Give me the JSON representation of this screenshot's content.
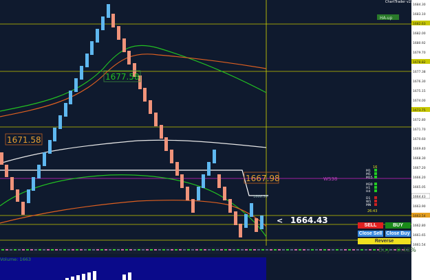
{
  "window": {
    "title": "ChartTrader v2.00"
  },
  "levels": {
    "l1": "1677.58",
    "l2": "1671.58",
    "l3": "1667.98",
    "current": "1664.43",
    "current_arrow": "<",
    "ha_badge": "HA-up",
    "ws_label": "WS38",
    "small_level": "1666.56"
  },
  "axis_prices": [
    "1684.30",
    "1683.10",
    "1682.63",
    "1682.00",
    "1680.92",
    "1679.70",
    "1678.82",
    "1677.38",
    "1676.30",
    "1675.15",
    "1674.00",
    "1673.75",
    "1672.80",
    "1671.70",
    "1670.60",
    "1669.40",
    "1668.30",
    "1667.20",
    "1666.20",
    "1665.05",
    "1664.43",
    "1663.90",
    "1663.54",
    "1662.80",
    "1661.65",
    "1661.54"
  ],
  "volume": {
    "label": "Volume: 1663"
  },
  "buy_sell_label": "Buy - 0.48%",
  "timeframes": [
    {
      "label": "M1",
      "val": ""
    },
    {
      "label": "M5",
      "val": ""
    },
    {
      "label": "M15",
      "val": ""
    },
    {
      "label": "M30",
      "val": ""
    },
    {
      "label": "H1",
      "val": ""
    },
    {
      "label": "H4",
      "val": ""
    },
    {
      "label": "D1",
      "val": ""
    },
    {
      "label": "W1",
      "val": ""
    },
    {
      "label": "MN",
      "val": ""
    }
  ],
  "tf_header": "16",
  "tf_footer": "26:43",
  "buttons": {
    "sell": "SELL",
    "buy": "BUY",
    "close_sell": "Close Sell",
    "close_buy": "Close Buy",
    "reverse": "Reverse"
  },
  "colors": {
    "bg": "#0f1a2e",
    "bull": "#5fb8f0",
    "bear": "#f0937a",
    "green": "#22c022",
    "orange": "#e06020",
    "white": "#e8e8e8",
    "yellow_line": "#d8d800",
    "magenta": "#a020a0"
  }
}
